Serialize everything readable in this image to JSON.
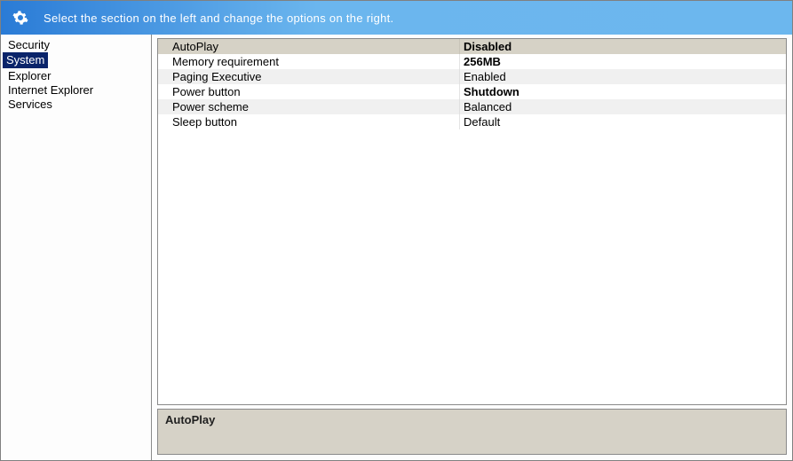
{
  "header": {
    "instruction": "Select the section on the left and change the options on the right."
  },
  "sidebar": {
    "items": [
      {
        "label": "Security",
        "selected": false
      },
      {
        "label": "System",
        "selected": true
      },
      {
        "label": "Explorer",
        "selected": false
      },
      {
        "label": "Internet Explorer",
        "selected": false
      },
      {
        "label": "Services",
        "selected": false
      }
    ]
  },
  "options": {
    "rows": [
      {
        "label": "AutoPlay",
        "value": "Disabled",
        "bold": true,
        "selected": true
      },
      {
        "label": "Memory requirement",
        "value": "256MB",
        "bold": true,
        "selected": false
      },
      {
        "label": "Paging Executive",
        "value": "Enabled",
        "bold": false,
        "selected": false
      },
      {
        "label": "Power button",
        "value": "Shutdown",
        "bold": true,
        "selected": false
      },
      {
        "label": "Power scheme",
        "value": "Balanced",
        "bold": false,
        "selected": false
      },
      {
        "label": "Sleep button",
        "value": "Default",
        "bold": false,
        "selected": false
      }
    ]
  },
  "description": {
    "title": "AutoPlay"
  }
}
